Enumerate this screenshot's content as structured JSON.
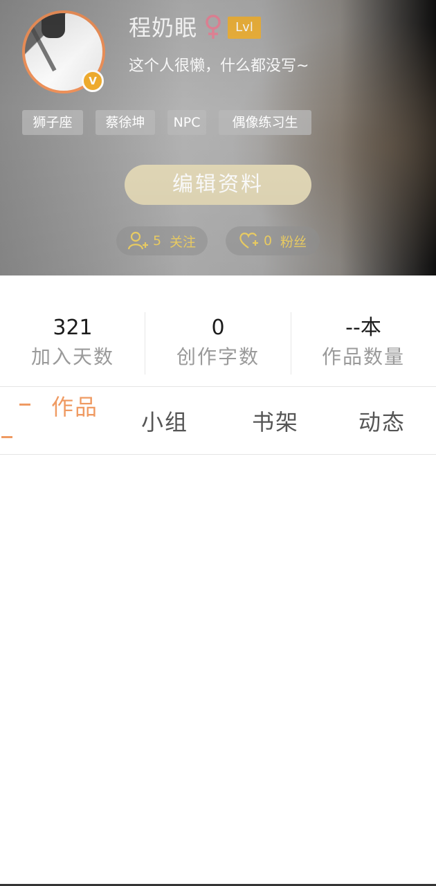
{
  "profile": {
    "username": "程奶眠",
    "gender_icon": "female-symbol",
    "level": "Lvl",
    "bio": "这个人很懒，什么都没写~",
    "vip_badge": "V",
    "tags": [
      "狮子座",
      "蔡徐坤",
      "NPC",
      "偶像练习生"
    ],
    "edit_button": "编辑资料",
    "following": {
      "count": "5",
      "label": "关注"
    },
    "fans": {
      "count": "0",
      "label": "粉丝"
    }
  },
  "stats": [
    {
      "value": "321",
      "label": "加入天数"
    },
    {
      "value": "0",
      "label": "创作字数"
    },
    {
      "value": "--本",
      "label": "作品数量"
    }
  ],
  "tabs": [
    {
      "label": "作品",
      "active": true
    },
    {
      "label": "小组",
      "active": false
    },
    {
      "label": "书架",
      "active": false
    },
    {
      "label": "动态",
      "active": false
    }
  ],
  "colors": {
    "accent": "#ef9a62",
    "level_badge": "#f0b43c",
    "pill_text": "#f3d466",
    "edit_button": "#e3d9b8",
    "gender": "#e8879a"
  }
}
